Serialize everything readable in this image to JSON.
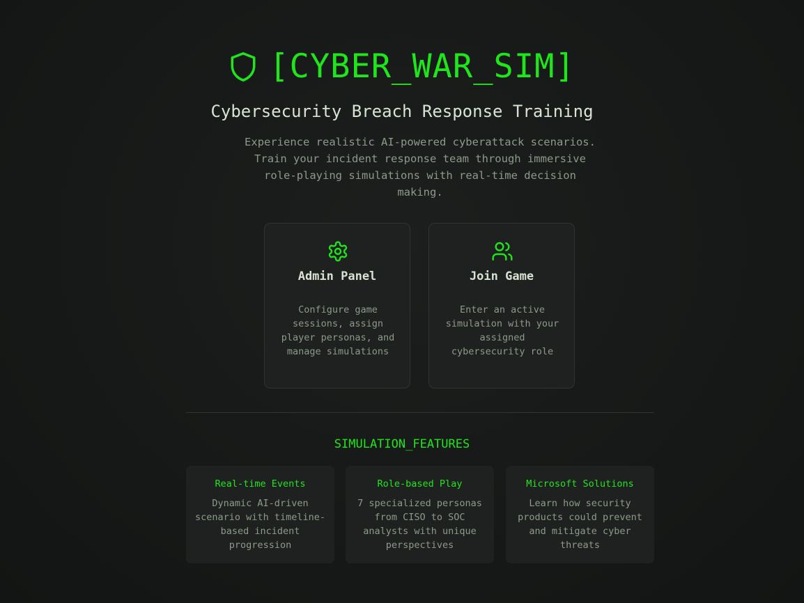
{
  "colors": {
    "accent": "#1ee61a",
    "background": "#151716",
    "card_background": "#1f2120",
    "title_text": "#d6e2d2",
    "muted_text": "#8c9b89"
  },
  "hero": {
    "icon": "shield-icon",
    "title": "[CYBER_WAR_SIM]",
    "subtitle": "Cybersecurity Breach Response Training",
    "description": "Experience realistic AI-powered cyberattack scenarios. Train your incident response team through immersive role-playing simulations with real-time decision making."
  },
  "actions": {
    "admin": {
      "icon": "gear-icon",
      "title": "Admin Panel",
      "description": "Configure game sessions, assign player personas, and manage simulations"
    },
    "join": {
      "icon": "users-icon",
      "title": "Join Game",
      "description": "Enter an active simulation with your assigned cybersecurity role"
    }
  },
  "features": {
    "heading": "SIMULATION_FEATURES",
    "items": [
      {
        "title": "Real-time Events",
        "description": "Dynamic AI-driven scenario with timeline-based incident progression"
      },
      {
        "title": "Role-based Play",
        "description": "7 specialized personas from CISO to SOC analysts with unique perspectives"
      },
      {
        "title": "Microsoft Solutions",
        "description": "Learn how security products could prevent and mitigate cyber threats"
      }
    ]
  }
}
